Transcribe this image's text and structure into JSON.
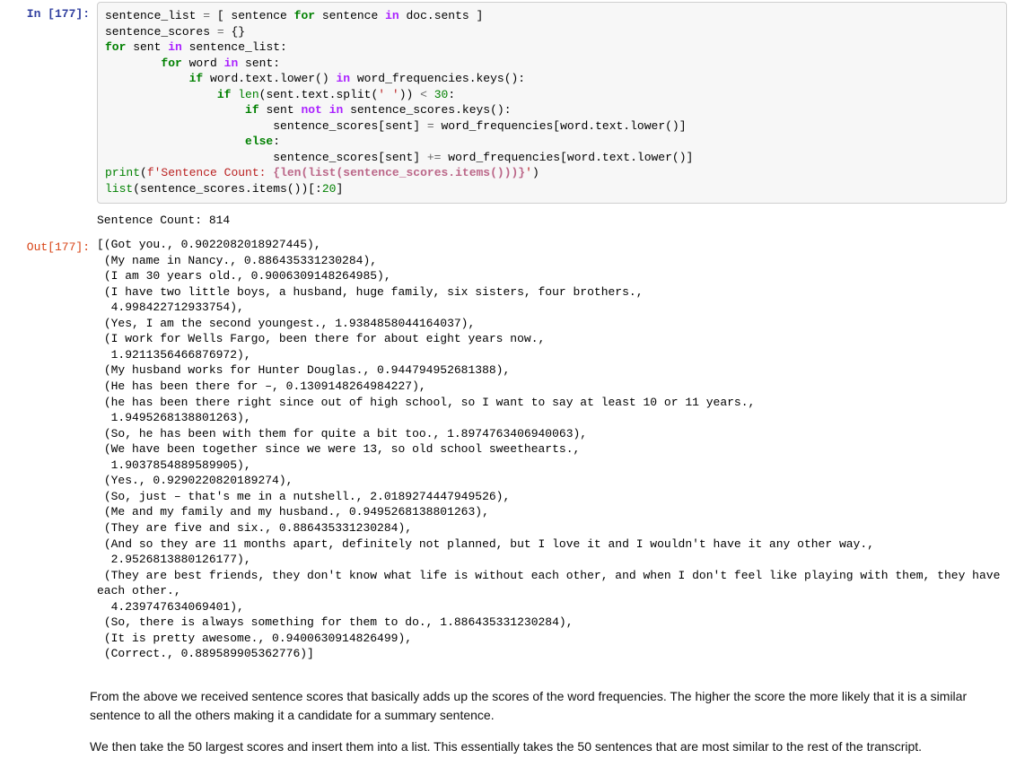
{
  "cell": {
    "in_prompt": "In [177]:",
    "out_prompt": "Out[177]:",
    "code_lines": [
      [
        {
          "t": "sentence_list ",
          "c": "n"
        },
        {
          "t": "=",
          "c": "o"
        },
        {
          "t": " [ sentence ",
          "c": "n"
        },
        {
          "t": "for",
          "c": "k"
        },
        {
          "t": " sentence ",
          "c": "n"
        },
        {
          "t": "in",
          "c": "op"
        },
        {
          "t": " doc.sents ]",
          "c": "n"
        }
      ],
      [
        {
          "t": "sentence_scores ",
          "c": "n"
        },
        {
          "t": "=",
          "c": "o"
        },
        {
          "t": " {}",
          "c": "n"
        }
      ],
      [
        {
          "t": "for",
          "c": "k"
        },
        {
          "t": " sent ",
          "c": "n"
        },
        {
          "t": "in",
          "c": "op"
        },
        {
          "t": " sentence_list:",
          "c": "n"
        }
      ],
      [
        {
          "t": "        ",
          "c": "n"
        },
        {
          "t": "for",
          "c": "k"
        },
        {
          "t": " word ",
          "c": "n"
        },
        {
          "t": "in",
          "c": "op"
        },
        {
          "t": " sent:",
          "c": "n"
        }
      ],
      [
        {
          "t": "            ",
          "c": "n"
        },
        {
          "t": "if",
          "c": "k"
        },
        {
          "t": " word.text.lower() ",
          "c": "n"
        },
        {
          "t": "in",
          "c": "op"
        },
        {
          "t": " word_frequencies.keys():",
          "c": "n"
        }
      ],
      [
        {
          "t": "                ",
          "c": "n"
        },
        {
          "t": "if",
          "c": "k"
        },
        {
          "t": " ",
          "c": "n"
        },
        {
          "t": "len",
          "c": "nb"
        },
        {
          "t": "(sent.text.split(",
          "c": "n"
        },
        {
          "t": "' '",
          "c": "s"
        },
        {
          "t": ")) ",
          "c": "n"
        },
        {
          "t": "<",
          "c": "o"
        },
        {
          "t": " ",
          "c": "n"
        },
        {
          "t": "30",
          "c": "nb"
        },
        {
          "t": ":",
          "c": "n"
        }
      ],
      [
        {
          "t": "                    ",
          "c": "n"
        },
        {
          "t": "if",
          "c": "k"
        },
        {
          "t": " sent ",
          "c": "n"
        },
        {
          "t": "not",
          "c": "op"
        },
        {
          "t": " ",
          "c": "n"
        },
        {
          "t": "in",
          "c": "op"
        },
        {
          "t": " sentence_scores.keys():",
          "c": "n"
        }
      ],
      [
        {
          "t": "                        sentence_scores[sent] ",
          "c": "n"
        },
        {
          "t": "=",
          "c": "o"
        },
        {
          "t": " word_frequencies[word.text.lower()]",
          "c": "n"
        }
      ],
      [
        {
          "t": "                    ",
          "c": "n"
        },
        {
          "t": "else",
          "c": "k"
        },
        {
          "t": ":",
          "c": "n"
        }
      ],
      [
        {
          "t": "                        sentence_scores[sent] ",
          "c": "n"
        },
        {
          "t": "+=",
          "c": "o"
        },
        {
          "t": " word_frequencies[word.text.lower()]",
          "c": "n"
        }
      ],
      [
        {
          "t": "print",
          "c": "nb"
        },
        {
          "t": "(",
          "c": "n"
        },
        {
          "t": "f'Sentence Count: ",
          "c": "s"
        },
        {
          "t": "{len(list(sentence_scores.items()))}",
          "c": "si"
        },
        {
          "t": "'",
          "c": "s"
        },
        {
          "t": ")",
          "c": "n"
        }
      ],
      [
        {
          "t": "list",
          "c": "nb"
        },
        {
          "t": "(sentence_scores.items())[:",
          "c": "n"
        },
        {
          "t": "20",
          "c": "nb"
        },
        {
          "t": "]",
          "c": "n"
        }
      ]
    ],
    "stdout": "Sentence Count: 814",
    "result": "[(Got you., 0.9022082018927445),\n (My name in Nancy., 0.886435331230284),\n (I am 30 years old., 0.9006309148264985),\n (I have two little boys, a husband, huge family, six sisters, four brothers.,\n  4.998422712933754),\n (Yes, I am the second youngest., 1.9384858044164037),\n (I work for Wells Fargo, been there for about eight years now.,\n  1.9211356466876972),\n (My husband works for Hunter Douglas., 0.944794952681388),\n (He has been there for –, 0.1309148264984227),\n (he has been there right since out of high school, so I want to say at least 10 or 11 years.,\n  1.9495268138801263),\n (So, he has been with them for quite a bit too., 1.8974763406940063),\n (We have been together since we were 13, so old school sweethearts.,\n  1.9037854889589905),\n (Yes., 0.9290220820189274),\n (So, just – that's me in a nutshell., 2.0189274447949526),\n (Me and my family and my husband., 0.9495268138801263),\n (They are five and six., 0.886435331230284),\n (And so they are 11 months apart, definitely not planned, but I love it and I wouldn't have it any other way.,\n  2.9526813880126177),\n (They are best friends, they don't know what life is without each other, and when I don't feel like playing with them, they have each other.,\n  4.239747634069401),\n (So, there is always something for them to do., 1.886435331230284),\n (It is pretty awesome., 0.9400630914826499),\n (Correct., 0.889589905362776)]"
  },
  "markdown": {
    "p1": "From the above we received sentence scores that basically adds up the scores of the word frequencies. The higher the score the more likely that it is a similar sentence to all the others making it a candidate for a summary sentence.",
    "p2": "We then take the 50 largest scores and insert them into a list. This essentially takes the 50 sentences that are most similar to the rest of the transcript."
  }
}
